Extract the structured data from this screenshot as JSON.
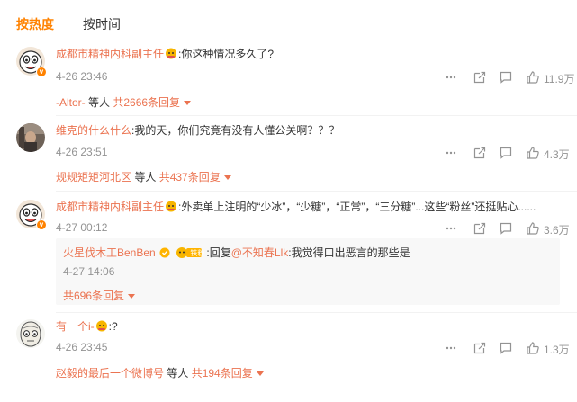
{
  "tabs": {
    "hot": "按热度",
    "time": "按时间"
  },
  "comments": [
    {
      "author": "成都市精神内科副主任",
      "separator": ":",
      "text": "你这种情况多久了?",
      "time": "4-26 23:46",
      "likes": "11.9万",
      "reply_summary": {
        "names": "-Altor-",
        "suffix": " 等人",
        "total": "共2666条回复"
      }
    },
    {
      "author": "维克的什么什么",
      "separator": ":",
      "text": "我的天，你们究竟有没有人懂公关啊？？？",
      "time": "4-26 23:51",
      "likes": "4.3万",
      "reply_summary": {
        "names": "规规矩矩河北区",
        "suffix": " 等人",
        "total": "共437条回复"
      }
    },
    {
      "author": "成都市精神内科副主任",
      "separator": ":",
      "text": "外卖单上注明的“少冰”，“少糖”，“正常”，“三分糖”...这些“粉丝”还挺贴心......",
      "time": "4-27 00:12",
      "likes": "3.6万",
      "sub_reply": {
        "author": "火星伐木工BenBen",
        "tag": "铁粉",
        "reply_prefix": ":回复",
        "mention": "@不知春Llk",
        "text": ":我觉得口出恶言的那些是",
        "time": "4-27 14:06",
        "total": "共696条回复"
      }
    },
    {
      "author": "有一个i-",
      "separator": ":",
      "text": "?",
      "time": "4-26 23:45",
      "likes": "1.3万",
      "reply_summary": {
        "names": "赵毅的最后一个微博号",
        "suffix": " 等人",
        "total": "共194条回复"
      }
    }
  ],
  "icons": [
    "more-icon",
    "share-icon",
    "comment-icon",
    "like-icon"
  ],
  "colors": {
    "accent": "#ff8200",
    "name": "#eb7350",
    "meta": "#939393"
  }
}
